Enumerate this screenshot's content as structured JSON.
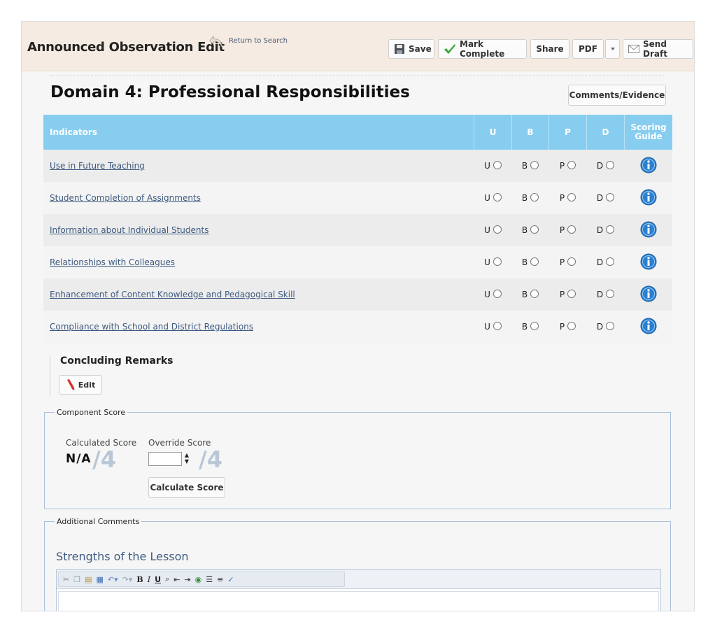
{
  "header": {
    "title": "Announced Observation Edit",
    "return_link": "Return to Search",
    "buttons": {
      "save": "Save",
      "mark_complete": "Mark Complete",
      "share": "Share",
      "pdf": "PDF",
      "send_draft": "Send Draft"
    }
  },
  "domain": {
    "title": "Domain 4: Professional Responsibilities",
    "comments_button": "Comments/Evidence"
  },
  "table": {
    "headers": {
      "indicators": "Indicators",
      "u": "U",
      "b": "B",
      "p": "P",
      "d": "D",
      "scoring_guide": "Scoring Guide"
    },
    "radio_labels": [
      "U",
      "B",
      "P",
      "D"
    ],
    "rows": [
      {
        "name": "Use in Future Teaching"
      },
      {
        "name": "Student Completion of Assignments"
      },
      {
        "name": "Information about Individual Students"
      },
      {
        "name": "Relationships with Colleagues"
      },
      {
        "name": "Enhancement of Content Knowledge and Pedagogical Skill"
      },
      {
        "name": "Compliance with School and District Regulations"
      }
    ]
  },
  "concluding": {
    "title": "Concluding Remarks",
    "edit_button": "Edit"
  },
  "component_score": {
    "legend": "Component Score",
    "calculated_label": "Calculated Score",
    "calculated_value": "N/A",
    "out_of": "/4",
    "override_label": "Override Score",
    "override_value": "",
    "override_out_of": "/4",
    "calculate_button": "Calculate Score"
  },
  "additional_comments": {
    "legend": "Additional Comments",
    "strengths_title": "Strengths of the Lesson",
    "editor_toolbar_icons": [
      "cut-icon",
      "copy-icon",
      "paste-icon",
      "paste-word-icon",
      "undo-icon",
      "redo-icon",
      "bold-icon",
      "italic-icon",
      "underline-icon",
      "find-icon",
      "outdent-icon",
      "indent-icon",
      "link-icon",
      "bullet-list-icon",
      "numbered-list-icon",
      "spellcheck-icon"
    ]
  },
  "colors": {
    "header_bg": "#f5ebe2",
    "table_header": "#87cdf0",
    "link": "#3d5a80",
    "info_icon": "#2a7fd0",
    "check_green": "#3aa63a"
  }
}
